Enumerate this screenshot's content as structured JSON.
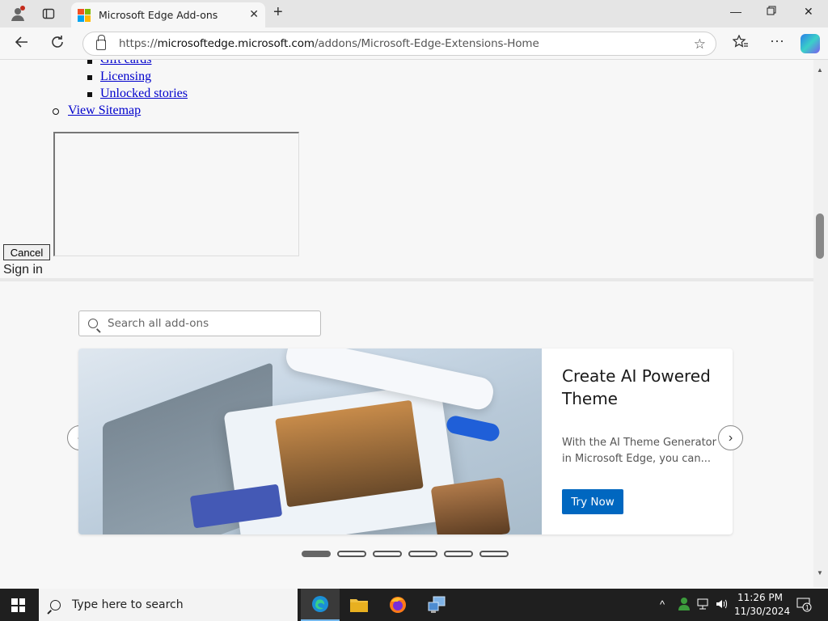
{
  "browser": {
    "tab_title": "Microsoft Edge Add-ons",
    "url_prefix": "https://",
    "url_host": "microsoftedge.microsoft.com",
    "url_path": "/addons/Microsoft-Edge-Extensions-Home"
  },
  "page": {
    "nav_links": [
      "Gift cards",
      "Licensing",
      "Unlocked stories"
    ],
    "sitemap_link": "View Sitemap",
    "cancel_label": "Cancel",
    "signin_text": "Sign in",
    "search_placeholder": "Search all add-ons",
    "carousel": {
      "title": "Create AI Powered Theme",
      "description": "With the AI Theme Generator in Microsoft Edge, you can...",
      "button_label": "Try Now",
      "slide_count": 6,
      "active_index": 0
    }
  },
  "taskbar": {
    "search_text": "Type here to search",
    "time": "11:26 PM",
    "date": "11/30/2024",
    "notification_count": "1"
  },
  "colors": {
    "link": "#0000cc",
    "accent": "#0067c0"
  }
}
